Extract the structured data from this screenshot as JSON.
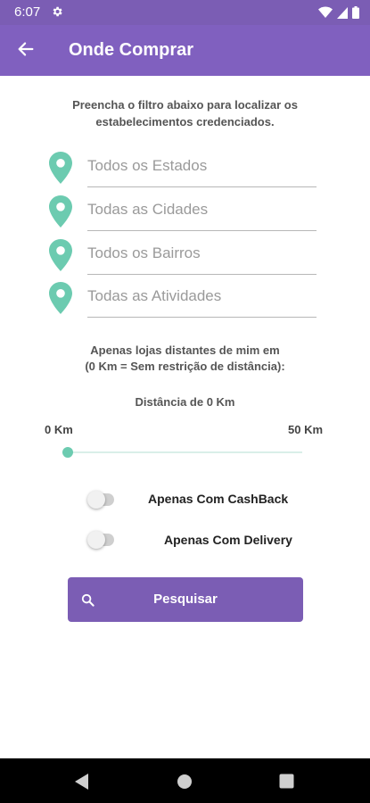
{
  "status_bar": {
    "time": "6:07"
  },
  "toolbar": {
    "title": "Onde Comprar"
  },
  "intro_text": "Preencha o filtro abaixo para localizar os estabelecimentos credenciados.",
  "filters": [
    {
      "placeholder": "Todos os Estados"
    },
    {
      "placeholder": "Todas as Cidades"
    },
    {
      "placeholder": "Todos os Bairros"
    },
    {
      "placeholder": "Todas as Atividades"
    }
  ],
  "distance": {
    "help_line1": "Apenas lojas distantes de mim em",
    "help_line2": "(0 Km = Sem restrição de distância):",
    "label": "Distância de 0 Km",
    "min_label": "0 Km",
    "max_label": "50 Km",
    "value_km": 0
  },
  "toggles": {
    "cashback": {
      "label": "Apenas Com CashBack",
      "checked": false
    },
    "delivery": {
      "label": "Apenas Com Delivery",
      "checked": false
    }
  },
  "search_button": {
    "label": "Pesquisar",
    "icon": "search-icon"
  },
  "colors": {
    "primary": "#7b5db4",
    "accent": "#6ccbb0"
  }
}
